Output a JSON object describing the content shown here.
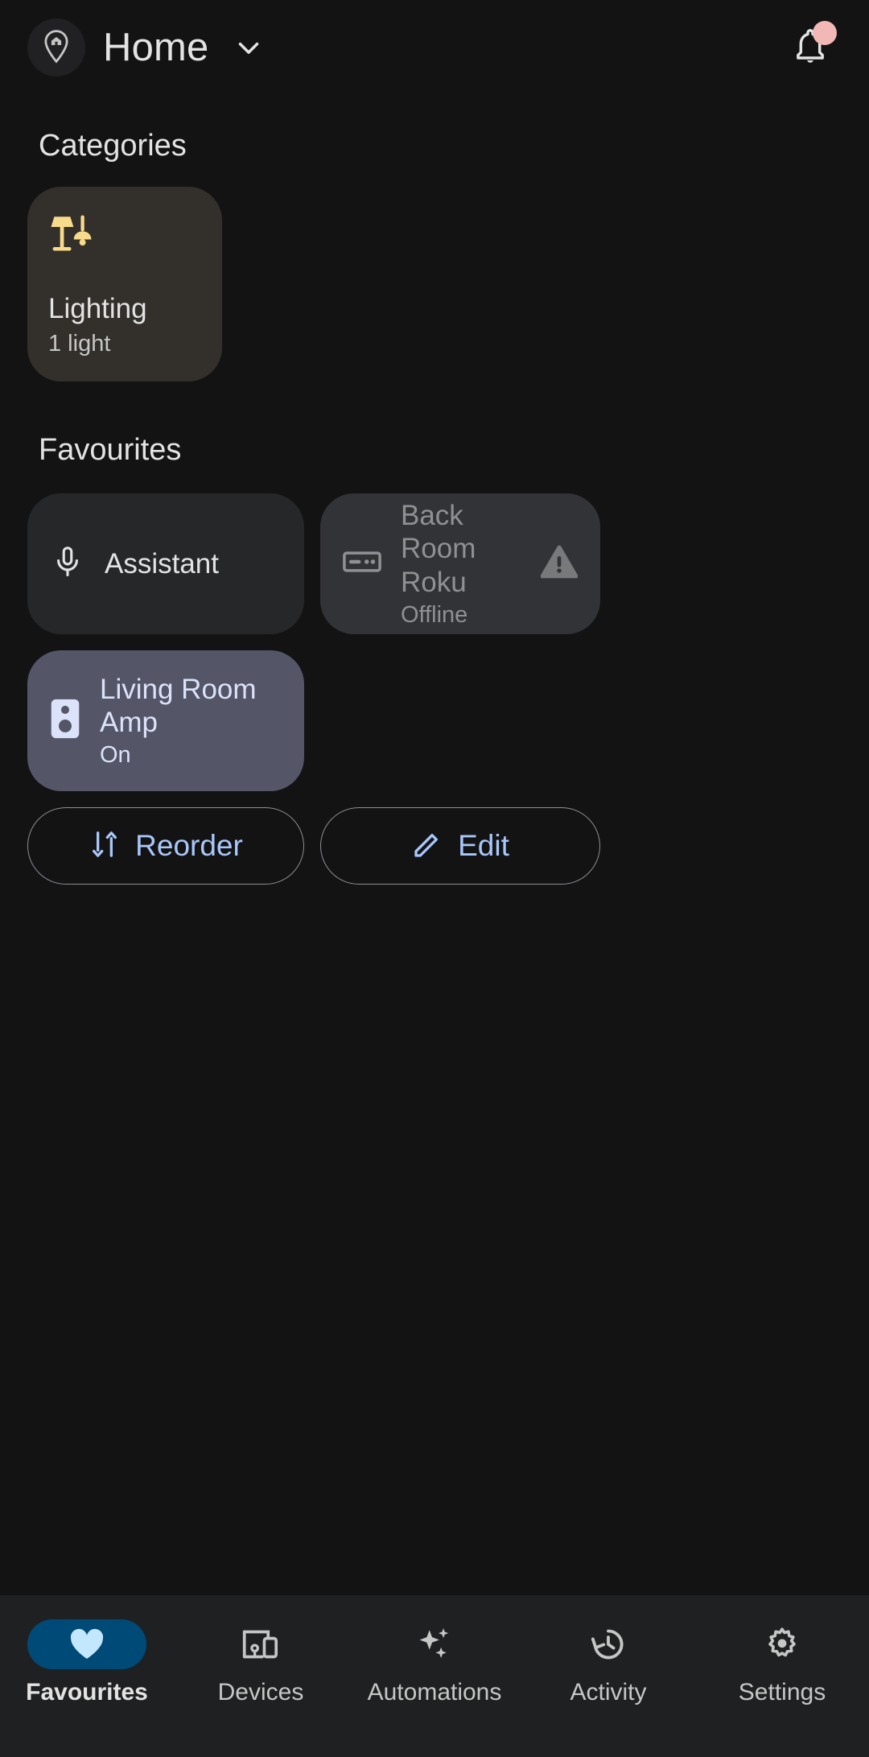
{
  "header": {
    "home_icon": "home-pin-icon",
    "title": "Home",
    "dropdown_icon": "chevron-down-icon",
    "notifications_icon": "bell-icon",
    "has_notification_badge": true,
    "badge_color": "#F2B8B5"
  },
  "categories": {
    "title": "Categories",
    "items": [
      {
        "icon": "lamp-icon",
        "icon_color": "#F8DA8B",
        "name": "Lighting",
        "subtitle": "1 light",
        "card_color": "#332F2B"
      }
    ]
  },
  "favourites": {
    "title": "Favourites",
    "items": [
      {
        "icon": "microphone-icon",
        "name": "Assistant",
        "state": "",
        "card_color": "#262729",
        "status_icon": ""
      },
      {
        "icon": "set-top-box-icon",
        "name": "Back Room Roku",
        "state": "Offline",
        "card_color": "#323336",
        "status_icon": "warning-icon"
      },
      {
        "icon": "speaker-icon",
        "name": "Living Room Amp",
        "state": "On",
        "card_color": "#545668",
        "status_icon": ""
      }
    ],
    "actions": [
      {
        "icon": "reorder-icon",
        "label": "Reorder"
      },
      {
        "icon": "pencil-icon",
        "label": "Edit"
      }
    ],
    "action_color": "#A8C7FA"
  },
  "bottom_nav": {
    "active_index": 0,
    "active_pill_color": "#004A77",
    "items": [
      {
        "icon": "heart-icon",
        "label": "Favourites"
      },
      {
        "icon": "devices-icon",
        "label": "Devices"
      },
      {
        "icon": "sparkle-icon",
        "label": "Automations"
      },
      {
        "icon": "history-icon",
        "label": "Activity"
      },
      {
        "icon": "gear-icon",
        "label": "Settings"
      }
    ]
  }
}
